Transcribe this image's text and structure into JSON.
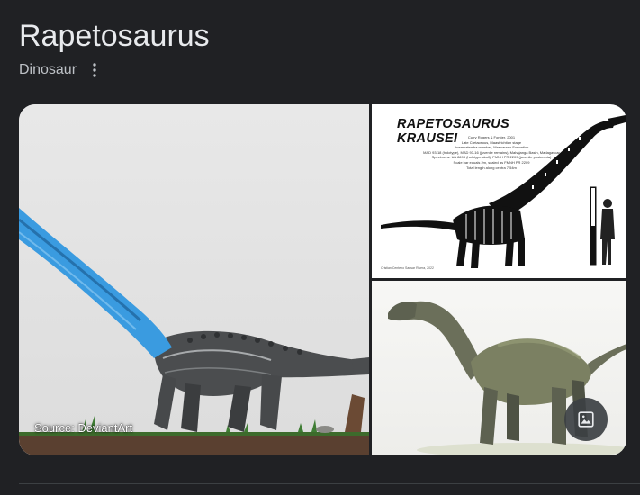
{
  "header": {
    "title": "Rapetosaurus",
    "subtitle": "Dinosaur",
    "more_icon": "more-vert-icon"
  },
  "gallery": {
    "main_image": {
      "source_label": "Source: DeviantArt",
      "accent_color": "#3a9be0"
    },
    "skeletal_image": {
      "title": "RAPETOSAURUS KRAUSEI",
      "notes": [
        "Curry Rogers & Forster, 2001",
        "Late Cretaceous, Maastrichtian stage",
        "Anembalemba member, Maevarano Formation",
        "MAD 93-18 (holotype), MAD 93-16 (juvenile remains), Mahajanga Basin, Madagascar",
        "Specimens: UA 8698 (holotype skull), FMNH PR 2209 (juvenile postcrania)",
        "Scale bar equals 2m, scaled as FMNH PR 2209",
        "Total length along centra 7.54m"
      ],
      "credit": "Cristian Centeno Sansar Rivera, 2022"
    },
    "render_image": {},
    "images_button_icon": "image-icon"
  }
}
